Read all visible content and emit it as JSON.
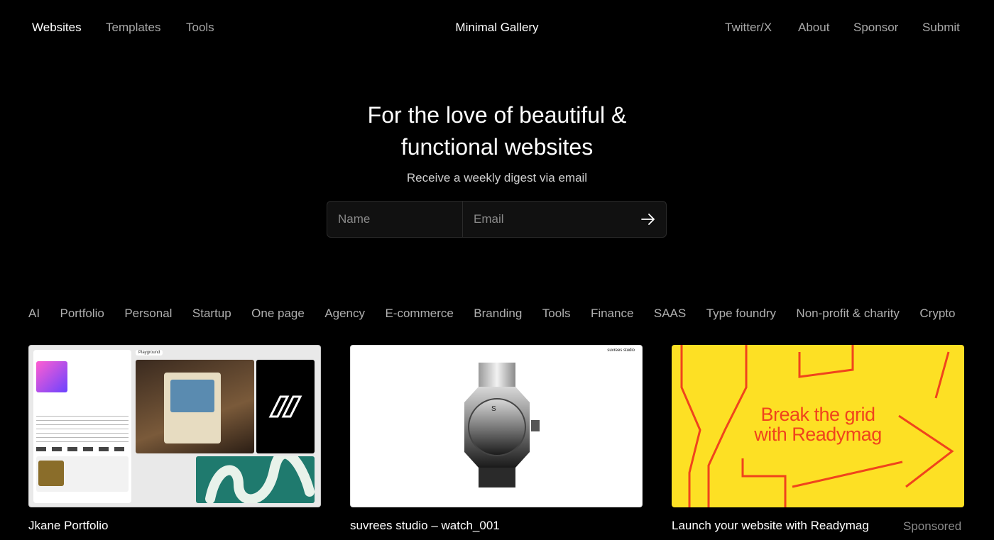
{
  "nav": {
    "left": [
      {
        "label": "Websites",
        "active": true
      },
      {
        "label": "Templates",
        "active": false
      },
      {
        "label": "Tools",
        "active": false
      }
    ],
    "brand": "Minimal Gallery",
    "right": [
      {
        "label": "Twitter/X"
      },
      {
        "label": "About"
      },
      {
        "label": "Sponsor"
      },
      {
        "label": "Submit"
      }
    ]
  },
  "hero": {
    "title_line1": "For the love of beautiful &",
    "title_line2": "functional websites",
    "subtitle": "Receive a weekly digest via email",
    "name_placeholder": "Name",
    "email_placeholder": "Email"
  },
  "categories": [
    "AI",
    "Portfolio",
    "Personal",
    "Startup",
    "One page",
    "Agency",
    "E-commerce",
    "Branding",
    "Tools",
    "Finance",
    "SAAS",
    "Type foundry",
    "Non-profit & charity",
    "Crypto"
  ],
  "cards": [
    {
      "title": "Jkane Portfolio",
      "preview_label": "Playground"
    },
    {
      "title": "suvrees studio – watch_001",
      "preview_label": "suvrees studio"
    },
    {
      "title": "Launch your website with Readymag",
      "badge": "Sponsored",
      "ad_line1": "Break the grid",
      "ad_line2": "with Readymag"
    }
  ],
  "colors": {
    "background": "#000000",
    "ad_yellow": "#fde024",
    "ad_orange": "#f0441c"
  },
  "icons": {
    "submit": "arrow-right-icon"
  }
}
